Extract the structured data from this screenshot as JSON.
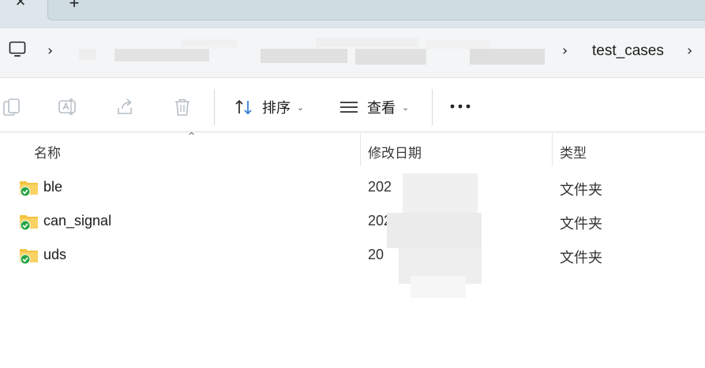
{
  "tabstrip": {
    "close_glyph": "×",
    "new_tab_glyph": "+"
  },
  "address": {
    "root_icon": "computer-icon",
    "current_folder": "test_cases",
    "separator_glyph": "›"
  },
  "toolbar": {
    "sort_label": "排序",
    "view_label": "查看",
    "more_glyph": "•••",
    "caret_glyph": "⌄",
    "icons": [
      "copy-icon",
      "rename-icon",
      "share-icon",
      "delete-icon"
    ]
  },
  "columns": {
    "name": "名称",
    "modified": "修改日期",
    "type": "类型",
    "sort_indicator": "^"
  },
  "files": [
    {
      "name": "ble",
      "modified": "202",
      "type": "文件夹"
    },
    {
      "name": "can_signal",
      "modified": "2026",
      "type": "文件夹"
    },
    {
      "name": "uds",
      "modified": "20",
      "type": "文件夹"
    }
  ],
  "colors": {
    "tabstrip_bg": "#dde6ea",
    "addressbar_bg": "#f3f5f6",
    "folder_yellow": "#f5c342",
    "sync_green": "#27a543"
  }
}
